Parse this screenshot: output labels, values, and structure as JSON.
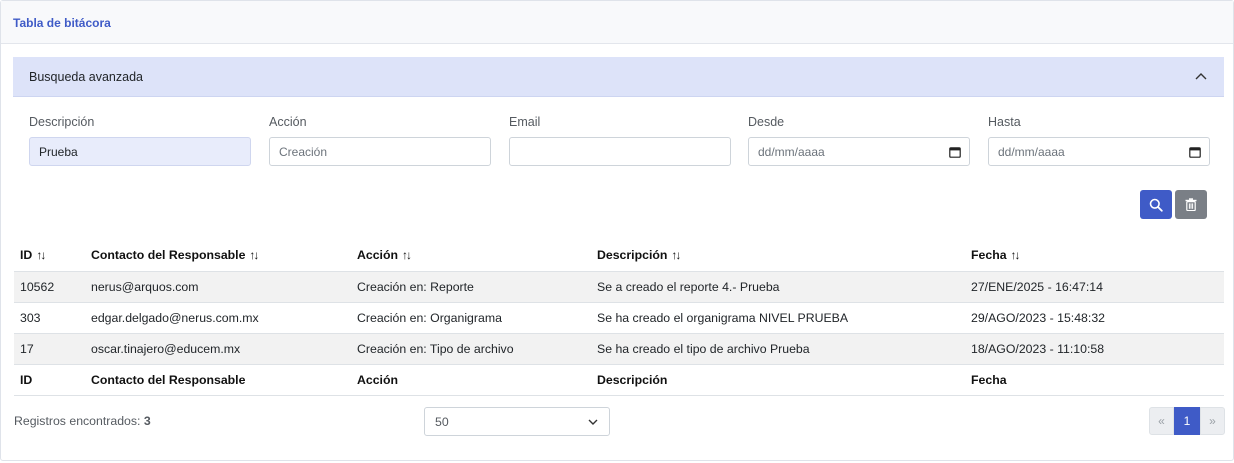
{
  "card": {
    "title": "Tabla de bitácora"
  },
  "advanced_search": {
    "label": "Busqueda avanzada",
    "expanded": true,
    "icon": "chevron-up-icon"
  },
  "filters": {
    "description": {
      "label": "Descripción",
      "value": "Prueba",
      "placeholder": ""
    },
    "action": {
      "label": "Acción",
      "value": "",
      "placeholder": "Creación"
    },
    "email": {
      "label": "Email",
      "value": "",
      "placeholder": ""
    },
    "from": {
      "label": "Desde",
      "placeholder": "dd/mm/aaaa",
      "icon": "calendar-icon"
    },
    "to": {
      "label": "Hasta",
      "placeholder": "dd/mm/aaaa",
      "icon": "calendar-icon"
    }
  },
  "buttons": {
    "search_icon": "search-icon",
    "clear_icon": "trash-icon",
    "search_color": "#3f5bc7",
    "clear_color": "#7a7f86"
  },
  "table": {
    "columns": [
      "ID",
      "Contacto del Responsable",
      "Acción",
      "Descripción",
      "Fecha"
    ],
    "sort_glyph": "↑↓",
    "rows": [
      [
        "10562",
        "nerus@arquos.com",
        "Creación en: Reporte",
        "Se a creado el reporte 4.- Prueba",
        "27/ENE/2025 - 16:47:14"
      ],
      [
        "303",
        "edgar.delgado@nerus.com.mx",
        "Creación en: Organigrama",
        "Se ha creado el organigrama NIVEL PRUEBA",
        "29/AGO/2023 - 15:48:32"
      ],
      [
        "17",
        "oscar.tinajero@educem.mx",
        "Creación en: Tipo de archivo",
        "Se ha creado el tipo de archivo Prueba",
        "18/AGO/2023 - 11:10:58"
      ]
    ]
  },
  "footer": {
    "records_label": "Registros encontrados:",
    "records_count": "3",
    "page_size": "50",
    "pagination": {
      "prev": "«",
      "current": "1",
      "next": "»"
    }
  },
  "colors": {
    "accent": "#3f5bc7",
    "header_bg": "#dde3f9"
  }
}
